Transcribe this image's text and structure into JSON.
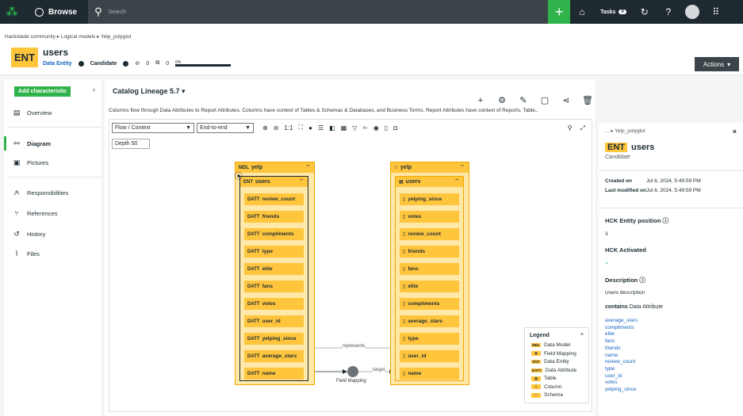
{
  "topbar": {
    "browse_label": "Browse",
    "search_placeholder": "Search",
    "tasks_label": "Tasks",
    "tasks_count": "0",
    "brand_color": "#2bcc55"
  },
  "header": {
    "breadcrumb": [
      "Hackolade community",
      "Logical models",
      "Yelp_polyglot"
    ],
    "badge": "ENT",
    "title": "users",
    "type": "Data Entity",
    "status": "Candidate",
    "comments_count": "0",
    "copies_count": "0",
    "progress": "0%",
    "progress_value": 0,
    "actions_label": "Actions"
  },
  "sidebar": {
    "add_label": "Add characteristic",
    "items": [
      {
        "label": "Overview"
      },
      {
        "label": "Diagram"
      },
      {
        "label": "Pictures"
      },
      {
        "label": "Responsibilities"
      },
      {
        "label": "References"
      },
      {
        "label": "History"
      },
      {
        "label": "Files"
      }
    ]
  },
  "main": {
    "lineage_label": "Catalog Lineage 5.7",
    "description": "Columns flow through Data Attributes to Report Attributes. Columns have context of Tables & Schemas & Databases, and Business Terms. Report Attributes have context of Reports, Table..",
    "flow_select": "Flow / Context",
    "scope_select": "End-to-end",
    "one_to_one": "1:1",
    "depth": "Depth 50"
  },
  "diagram": {
    "model": {
      "tag": "MDL",
      "name": "yelp"
    },
    "entity": {
      "tag": "ENT",
      "name": "users"
    },
    "attr_tag": "DATT",
    "attributes": [
      "review_count",
      "friends",
      "compliments",
      "type",
      "elite",
      "fans",
      "votes",
      "user_id",
      "yelping_since",
      "average_stars",
      "name"
    ],
    "schema": {
      "name": "yelp"
    },
    "table": {
      "name": "users"
    },
    "columns": [
      "yelping_since",
      "votes",
      "review_count",
      "friends",
      "fans",
      "elite",
      "compliments",
      "average_stars",
      "type",
      "user_id",
      "name"
    ],
    "edge_represents": "represents",
    "edge_target": "target",
    "field_mapping_label": "Field Mapping"
  },
  "legend": {
    "title": "Legend",
    "items": [
      {
        "badge": "MDL",
        "label": "Data Model"
      },
      {
        "badge": "◉",
        "label": "Field Mapping"
      },
      {
        "badge": "ENT",
        "label": "Data Entity"
      },
      {
        "badge": "DATT",
        "label": "Data Attribute"
      },
      {
        "badge": "▦",
        "label": "Table"
      },
      {
        "badge": "▯",
        "label": "Column"
      },
      {
        "badge": "⁘",
        "label": "Schema"
      }
    ]
  },
  "panel": {
    "breadcrumb": "... ▸ Yelp_polyglot",
    "badge": "ENT",
    "title": "users",
    "status": "Candidate",
    "created_label": "Created on",
    "created_value": "Jul 6, 2024, 5:49:59 PM",
    "modified_label": "Last modified on",
    "modified_value": "Jul 6, 2024, 5:49:59 PM",
    "hck_position_label": "HCK Entity position",
    "hck_position_value": "3",
    "hck_activated_label": "HCK Activated",
    "hck_activated_value": "✓",
    "description_label": "Description",
    "description_value": "Users description",
    "contains_label": "contains",
    "contains_type": "Data Attribute",
    "contains_items": [
      "average_stars",
      "compliments",
      "elite",
      "fans",
      "friends",
      "name",
      "review_count",
      "type",
      "user_id",
      "votes",
      "yelping_since"
    ]
  }
}
